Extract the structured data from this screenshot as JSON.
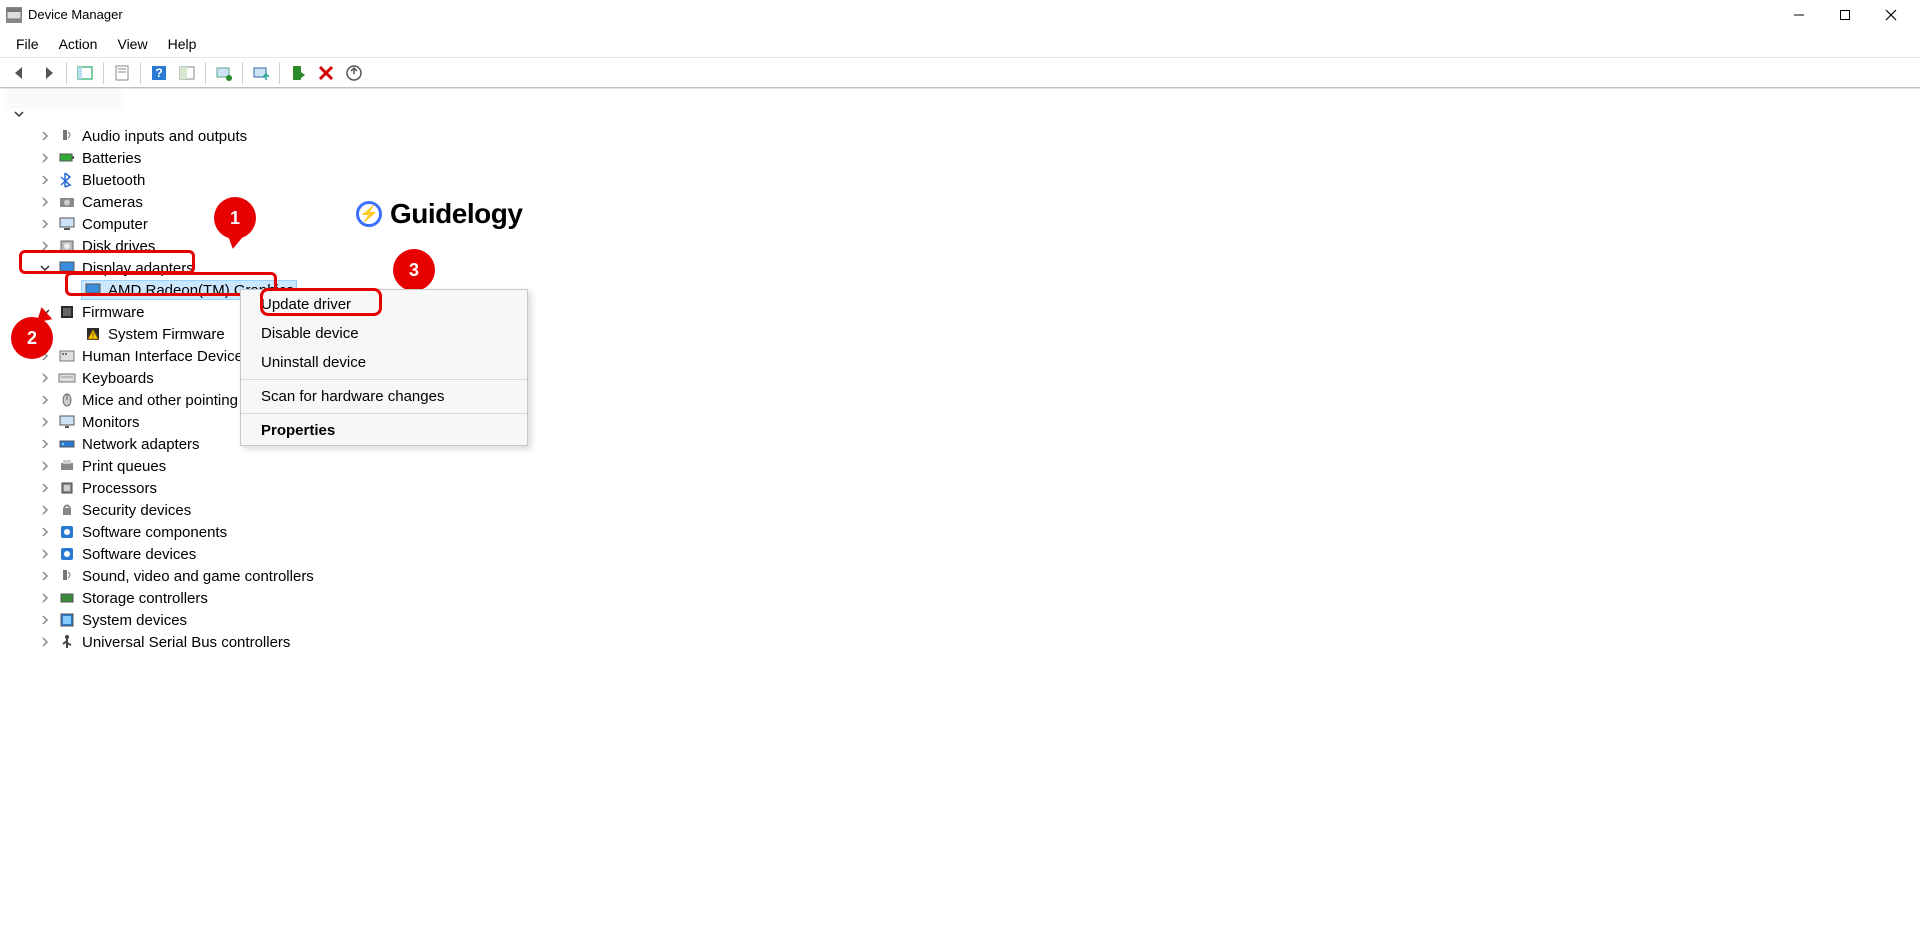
{
  "window": {
    "title": "Device Manager"
  },
  "menubar": {
    "items": [
      "File",
      "Action",
      "View",
      "Help"
    ]
  },
  "toolbar": {
    "buttons": [
      "back",
      "forward",
      "show-hide-console",
      "properties",
      "help",
      "show-hidden",
      "scan-hardware",
      "update-driver",
      "enable",
      "disable",
      "uninstall"
    ]
  },
  "tree": {
    "root": "",
    "categories": [
      {
        "label": "Audio inputs and outputs",
        "expanded": false,
        "icon": "audio"
      },
      {
        "label": "Batteries",
        "expanded": false,
        "icon": "battery"
      },
      {
        "label": "Bluetooth",
        "expanded": false,
        "icon": "bluetooth"
      },
      {
        "label": "Cameras",
        "expanded": false,
        "icon": "camera"
      },
      {
        "label": "Computer",
        "expanded": false,
        "icon": "computer"
      },
      {
        "label": "Disk drives",
        "expanded": false,
        "icon": "disk"
      },
      {
        "label": "Display adapters",
        "expanded": true,
        "icon": "display",
        "highlight": 1,
        "children": [
          {
            "label": "AMD Radeon(TM) Graphics",
            "icon": "display",
            "selected": true,
            "highlight": 2
          }
        ]
      },
      {
        "label": "Firmware",
        "expanded": true,
        "icon": "firmware",
        "children": [
          {
            "label": "System Firmware",
            "icon": "firmware-warn"
          }
        ]
      },
      {
        "label": "Human Interface Devices",
        "expanded": false,
        "icon": "hid"
      },
      {
        "label": "Keyboards",
        "expanded": false,
        "icon": "keyboard"
      },
      {
        "label": "Mice and other pointing devices",
        "expanded": false,
        "icon": "mouse"
      },
      {
        "label": "Monitors",
        "expanded": false,
        "icon": "monitor"
      },
      {
        "label": "Network adapters",
        "expanded": false,
        "icon": "network"
      },
      {
        "label": "Print queues",
        "expanded": false,
        "icon": "printer"
      },
      {
        "label": "Processors",
        "expanded": false,
        "icon": "cpu"
      },
      {
        "label": "Security devices",
        "expanded": false,
        "icon": "security"
      },
      {
        "label": "Software components",
        "expanded": false,
        "icon": "software"
      },
      {
        "label": "Software devices",
        "expanded": false,
        "icon": "software"
      },
      {
        "label": "Sound, video and game controllers",
        "expanded": false,
        "icon": "audio"
      },
      {
        "label": "Storage controllers",
        "expanded": false,
        "icon": "storage"
      },
      {
        "label": "System devices",
        "expanded": false,
        "icon": "system"
      },
      {
        "label": "Universal Serial Bus controllers",
        "expanded": false,
        "icon": "usb"
      }
    ]
  },
  "context_menu": {
    "items": [
      {
        "label": "Update driver",
        "highlight": 3
      },
      {
        "label": "Disable device"
      },
      {
        "label": "Uninstall device"
      },
      {
        "separator": true
      },
      {
        "label": "Scan for hardware changes"
      },
      {
        "separator": true
      },
      {
        "label": "Properties",
        "bold": true
      }
    ]
  },
  "annotations": {
    "badges": [
      "1",
      "2",
      "3"
    ]
  },
  "watermark": {
    "text": "Guidelogy"
  }
}
